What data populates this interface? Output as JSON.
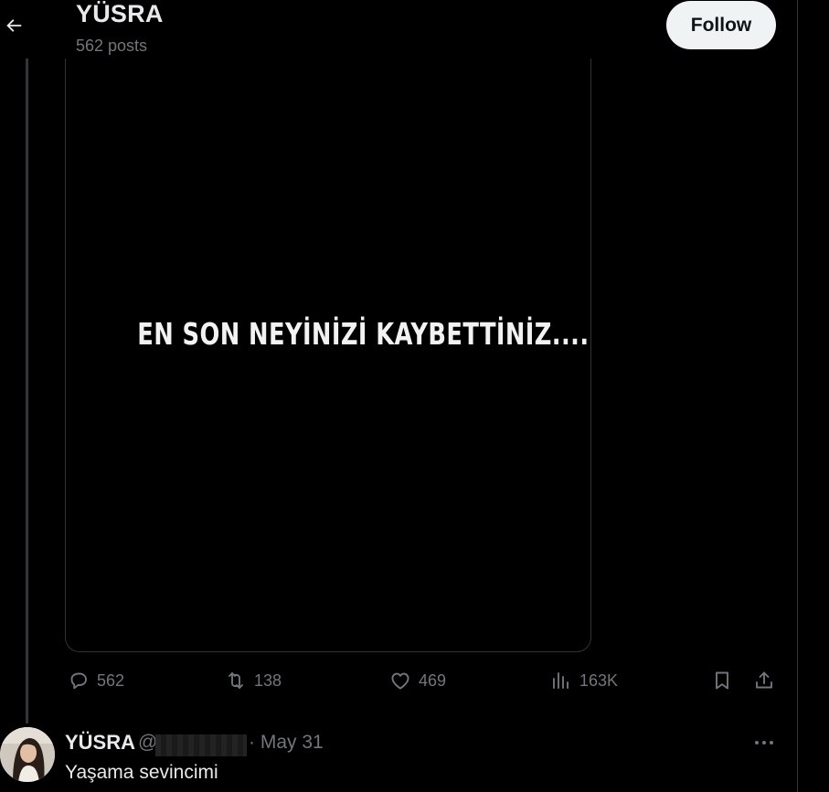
{
  "header": {
    "name": "YÜSRA",
    "posts": "562 posts",
    "follow_label": "Follow"
  },
  "post": {
    "media_text": "EN SON NEYİNİZİ KAYBETTİNİZ....",
    "actions": {
      "replies": "562",
      "reposts": "138",
      "likes": "469",
      "views": "163K"
    }
  },
  "reply": {
    "name": "YÜSRA",
    "handle_prefix": "@",
    "date": "· May 31",
    "text": "Yaşama sevincimi"
  },
  "icons": [
    "back-arrow-icon",
    "reply-icon",
    "retweet-icon",
    "like-icon",
    "views-icon",
    "bookmark-icon",
    "share-icon",
    "more-icon"
  ],
  "colors": {
    "background": "#000000",
    "text": "#e7e9ea",
    "muted": "#71767b",
    "border": "#2f3336",
    "follow_bg": "#eff3f4"
  }
}
